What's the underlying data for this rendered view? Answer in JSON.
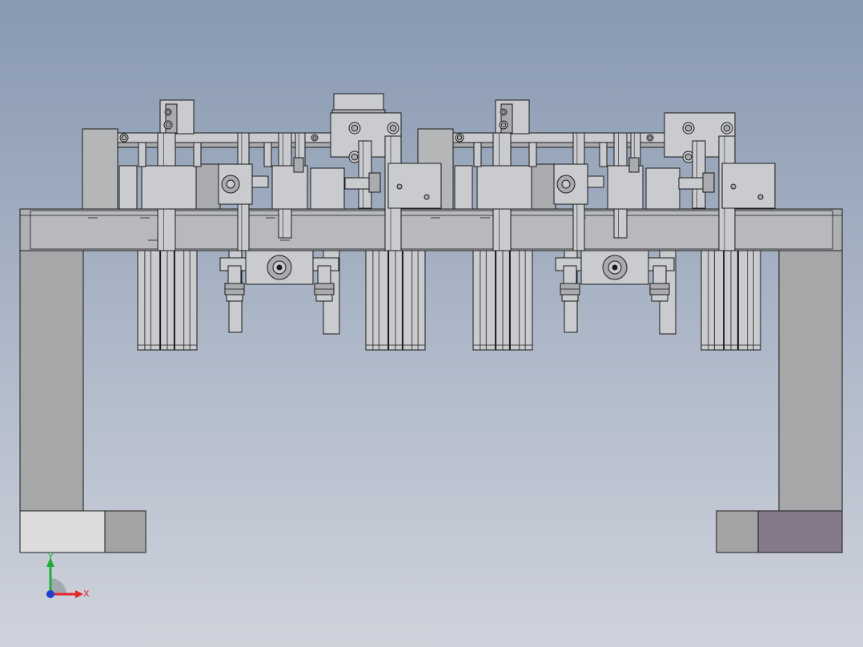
{
  "viewport": {
    "background_top": "#8899b1",
    "background_bottom": "#cfd3dc"
  },
  "model": {
    "line_color": "#1a1a1a",
    "steel_light": "#c9cbce",
    "steel_mid": "#a9abae",
    "steel_dark": "#8c8e91",
    "plate_color": "#aeb0b4",
    "leg_color": "#a6a7a9",
    "foot_left_light": "#dcdcdc",
    "foot_mid": "#a4a4a4",
    "foot_right_tint": "#857a8a",
    "block_dark": "#b5b6b8"
  },
  "triad": {
    "x_label": "X",
    "y_label": "Y",
    "x_color": "#e2262b",
    "y_color": "#1fae3a",
    "z_color": "#1f3fcf"
  }
}
